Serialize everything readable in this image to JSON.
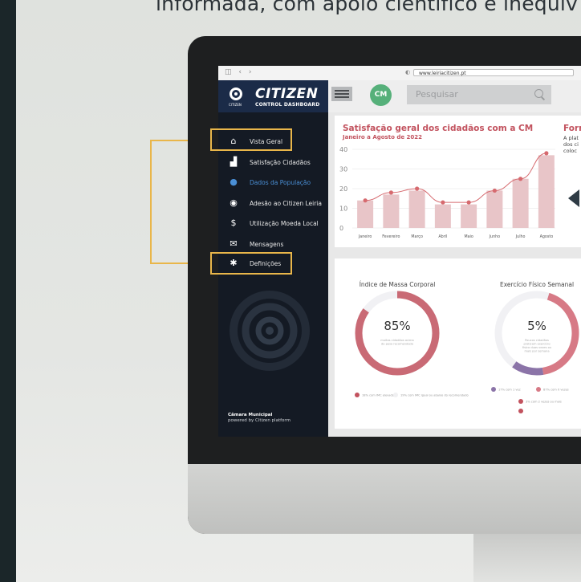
{
  "headline": "informada, com apoio científico e inequív",
  "browser": {
    "url": "www.leiriacitizen.pt",
    "nav_glyphs": "◫  ‹  ›",
    "lock_glyph": "◐"
  },
  "brand": {
    "title": "CITIZEN",
    "subtitle": "CONTROL DASHBOARD",
    "small": "CITIZEN"
  },
  "sidebar": {
    "items": [
      {
        "label": "Vista Geral",
        "icon": "home-icon",
        "glyph": "⌂"
      },
      {
        "label": "Satisfação Cidadãos",
        "icon": "signal-bars-icon",
        "glyph": "▟"
      },
      {
        "label": "Dados da População",
        "icon": "person-icon",
        "glyph": "●"
      },
      {
        "label": "Adesão ao Citizen Leiria",
        "icon": "citizen-logo-icon",
        "glyph": "◉"
      },
      {
        "label": "Utilização Moeda Local",
        "icon": "coin-icon",
        "glyph": "$"
      },
      {
        "label": "Mensagens",
        "icon": "envelope-icon",
        "glyph": "✉"
      },
      {
        "label": "Definições",
        "icon": "gear-icon",
        "glyph": "✱"
      }
    ],
    "active_item": "Dados da População",
    "footer_title": "Câmara Municipal",
    "footer_sub": "powered by Citizen platform"
  },
  "topbar": {
    "avatar_initials": "CM",
    "search_placeholder": "Pesquisar"
  },
  "satisfaction_card": {
    "title": "Satisfação geral dos cidadãos com a CM",
    "subtitle": "Janeiro a Agosto de 2022"
  },
  "chart_data": {
    "type": "bar",
    "title": "Satisfação geral dos cidadãos com a CM",
    "subtitle": "Janeiro a Agosto de 2022",
    "categories": [
      "Janeiro",
      "Fevereiro",
      "Março",
      "Abril",
      "Maio",
      "Junho",
      "Julho",
      "Agosto"
    ],
    "series": [
      {
        "type": "bar",
        "values": [
          14,
          17,
          19,
          12,
          12,
          19,
          25,
          37
        ]
      },
      {
        "type": "line",
        "values": [
          14,
          18,
          20,
          13,
          13,
          19,
          25,
          38
        ]
      }
    ],
    "yticks": [
      "0",
      "10",
      "20",
      "30",
      "40"
    ],
    "ylim": [
      0,
      40
    ],
    "grid": true
  },
  "second_card": {
    "title": "Form",
    "text": "A plat\ndos ci\ncoloc"
  },
  "donuts": [
    {
      "title": "Índice de Massa Corporal",
      "value": "85%",
      "fraction": 0.85,
      "center_text": "muitos cidadãos acima do peso recomendado",
      "legend": [
        "18% com IMC elevado",
        "19% com IMC igual ou abaixo do recomendado"
      ]
    },
    {
      "title": "Exercício Físico Semanal",
      "value": "5%",
      "fraction": 0.05,
      "center_text": "Poucos cidadãos praticam exercício físico duas vezes ou mais por semana",
      "legend": [
        "17% com 1 vez",
        "87% com 0 vezes",
        "3% com 2 vezes ou mais"
      ]
    }
  ],
  "colors": {
    "accent": "#c2525e",
    "bar": "#e8c5c8",
    "line": "#d66a6f",
    "sidebar_bg": "#141a24",
    "brand_bg": "#1b2b48",
    "highlight": "#e9b64a",
    "active_menu": "#4a8fd6",
    "avatar": "#56b07a"
  }
}
